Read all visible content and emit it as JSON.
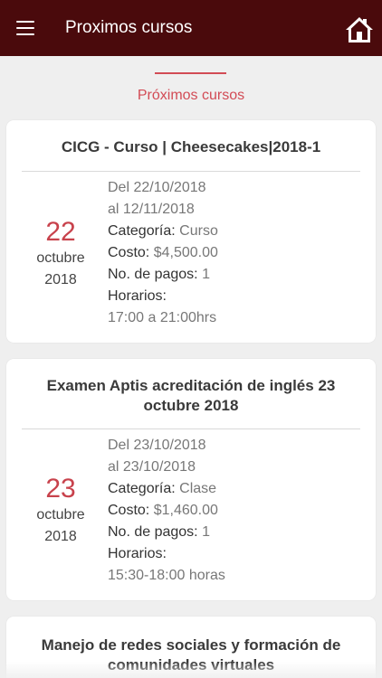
{
  "header": {
    "title": "Proximos cursos",
    "menu_icon": "menu-icon",
    "home_icon": "home-icon",
    "bar_color": "#4a0a0c"
  },
  "tab": {
    "label": "Próximos cursos",
    "accent": "#d24b55"
  },
  "courses": [
    {
      "title": "CICG - Curso | Cheesecakes|2018-1",
      "day": "22",
      "month": "octubre",
      "year": "2018",
      "from": "Del 22/10/2018",
      "to": "al 12/11/2018",
      "categoria_label": "Categoría:",
      "categoria": "Curso",
      "costo_label": "Costo:",
      "costo": "$4,500.00",
      "pagos_label": "No. de pagos:",
      "pagos": "1",
      "horarios_label": "Horarios:",
      "horarios": "17:00 a 21:00hrs"
    },
    {
      "title": "Examen Aptis acreditación de inglés 23 octubre 2018",
      "day": "23",
      "month": "octubre",
      "year": "2018",
      "from": "Del 23/10/2018",
      "to": "al 23/10/2018",
      "categoria_label": "Categoría:",
      "categoria": "Clase",
      "costo_label": "Costo:",
      "costo": "$1,460.00",
      "pagos_label": "No. de pagos:",
      "pagos": "1",
      "horarios_label": "Horarios:",
      "horarios": "15:30-18:00 horas"
    },
    {
      "title": "Manejo de redes sociales y formación de comunidades virtuales"
    }
  ]
}
